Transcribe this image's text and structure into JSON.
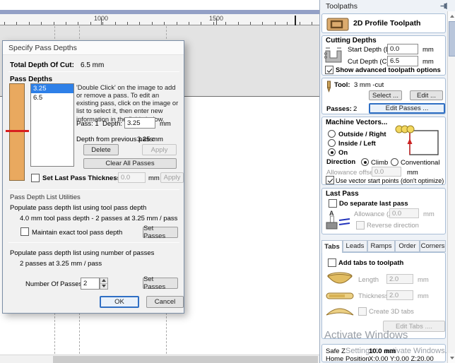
{
  "ruler": {
    "label1": "1000",
    "label2": "1500"
  },
  "dialog": {
    "title": "Specify Pass Depths",
    "total_depth_label": "Total Depth Of Cut:",
    "total_depth_value": "6.5 mm",
    "pass_depths_label": "Pass Depths",
    "pass_list": [
      "3.25",
      "6.5"
    ],
    "help_text": "'Double Click' on the image to add or remove a pass. To edit an existing pass, click on the image or list to select it, then enter new information in the fields below.",
    "pass_label": "Pass: 1",
    "depth_label": "Depth:",
    "depth_value": "3.25",
    "unit_mm": "mm",
    "prev_pass_label": "Depth from previous pass:",
    "prev_pass_value": "3.25 mm",
    "delete_button": "Delete",
    "apply_button": "Apply",
    "clear_button": "Clear All Passes",
    "set_last_pass_label": "Set Last Pass Thickness",
    "set_last_pass_value": "0.0",
    "utilities": {
      "title": "Pass Depth List Utilities",
      "tool_pass_label": "Populate pass depth list using tool pass depth",
      "tool_pass_info": "4.0 mm tool pass depth - 2 passes at 3.25 mm / pass",
      "maintain_label": "Maintain exact tool pass depth",
      "set_passes_button": "Set Passes",
      "num_pass_label": "Populate pass depth list using number of passes",
      "num_pass_info": "2 passes at 3.25 mm / pass",
      "number_of_passes_label": "Number Of Passes:",
      "number_of_passes_value": "2",
      "set_passes_button2": "Set Passes"
    },
    "ok_button": "OK",
    "cancel_button": "Cancel"
  },
  "panel": {
    "title": "Toolpaths",
    "toolpath_name": "2D Profile Toolpath",
    "cutting_depths": {
      "title": "Cutting Depths",
      "start_depth_label": "Start Depth (D)",
      "start_depth_value": "0.0",
      "cut_depth_label": "Cut Depth (C)",
      "cut_depth_value": "6.5",
      "unit_mm": "mm",
      "advanced_label": "Show advanced toolpath options"
    },
    "tool": {
      "label": "Tool:",
      "name": "3 mm -cut",
      "select_button": "Select ...",
      "edit_button": "Edit ..."
    },
    "passes": {
      "label": "Passes:",
      "value": "2",
      "edit_button": "Edit Passes ..."
    },
    "machine_vectors": {
      "title": "Machine Vectors...",
      "option_outside": "Outside / Right",
      "option_inside": "Inside / Left",
      "option_on": "On",
      "direction_label": "Direction",
      "dir_climb": "Climb",
      "dir_conventional": "Conventional",
      "allowance_label": "Allowance offset",
      "allowance_value": "0.0",
      "unit_mm": "mm",
      "start_points_label": "Use vector start points (don't optimize)"
    },
    "last_pass": {
      "title": "Last Pass",
      "separate_label": "Do separate last pass",
      "allowance_label": "Allowance (A)",
      "allowance_value": "0.0",
      "unit_mm": "mm",
      "reverse_label": "Reverse direction"
    },
    "tabs_section": {
      "tabs": [
        "Tabs",
        "Leads",
        "Ramps",
        "Order",
        "Corners"
      ],
      "add_tabs_label": "Add tabs to toolpath",
      "length_label": "Length",
      "length_value": "2.0",
      "thickness_label": "Thickness",
      "thickness_value": "2.0",
      "unit_mm": "mm",
      "create_3d_label": "Create 3D tabs",
      "edit_tabs_button": "Edit Tabs ...."
    },
    "footer": {
      "safe_z_label": "Safe Z",
      "safe_z_value": "10.0 mm",
      "home_label": "Home Position",
      "home_value": "X:0.00 Y:0.00 Z:20.00"
    }
  },
  "watermark": {
    "line1": "Activate Windows",
    "line2": "Settings to activate Windows."
  },
  "colors": {
    "accent_blue": "#2f6fc4",
    "selection_blue": "#2e80e8",
    "material_orange": "#e9a95f",
    "pass_line_red": "#d81f1f",
    "top_bar_blue": "#93a0c6",
    "panel_bg": "#eef2f7"
  }
}
